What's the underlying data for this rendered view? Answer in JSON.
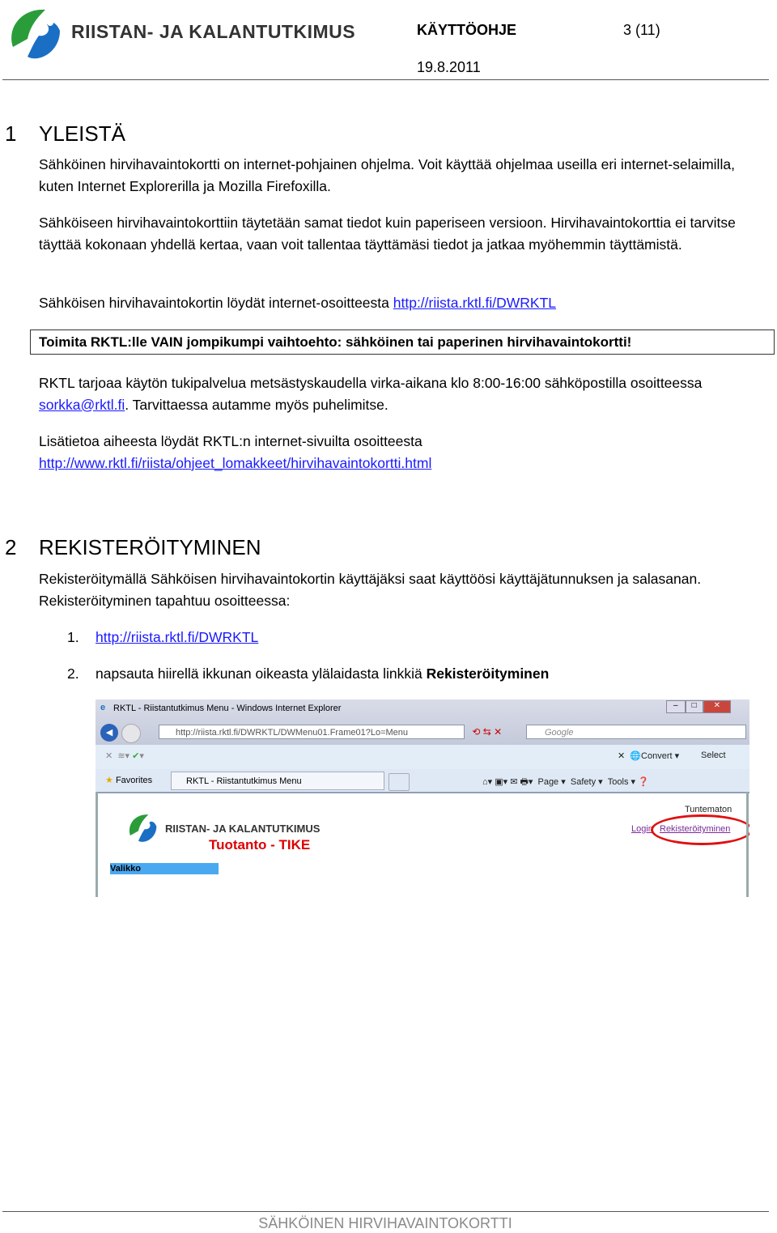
{
  "header": {
    "logo_text": "RIISTAN- JA KALANTUTKIMUS",
    "doc_type": "KÄYTTÖOHJE",
    "page": "3 (11)",
    "date": "19.8.2011"
  },
  "section1": {
    "number": "1",
    "title": "YLEISTÄ",
    "p1": "Sähköinen hirvihavaintokortti on internet-pohjainen ohjelma. Voit käyttää ohjelmaa useilla eri internet-selaimilla, kuten Internet Explorerilla ja Mozilla Firefoxilla.",
    "p2": "Sähköiseen hirvihavaintokorttiin täytetään samat tiedot kuin paperiseen versioon. Hirvihavaintokorttia ei tarvitse täyttää kokonaan yhdellä kertaa, vaan voit tallentaa täyttämäsi tiedot ja jatkaa myöhemmin täyttämistä.",
    "p3_text": "Sähköisen hirvihavaintokortin löydät internet-osoitteesta ",
    "p3_link": "http://riista.rktl.fi/DWRKTL",
    "notice": "Toimita RKTL:lle VAIN jompikumpi vaihtoehto: sähköinen tai paperinen hirvihavaintokortti!",
    "p4_text1": "RKTL tarjoaa käytön tukipalvelua metsästyskaudella virka-aikana klo 8:00-16:00 sähköpostilla osoitteessa ",
    "p4_link": "sorkka@rktl.fi",
    "p4_text2": ". Tarvittaessa autamme myös puhelimitse.",
    "p5_text": "Lisätietoa aiheesta löydät RKTL:n internet-sivuilta osoitteesta",
    "p5_link": "http://www.rktl.fi/riista/ohjeet_lomakkeet/hirvihavaintokortti.html"
  },
  "section2": {
    "number": "2",
    "title": "REKISTERÖITYMINEN",
    "p1": "Rekisteröitymällä Sähköisen hirvihavaintokortin käyttäjäksi saat käyttöösi käyttäjätunnuksen ja salasanan. Rekisteröityminen tapahtuu osoitteessa:",
    "list": [
      {
        "num": "1.",
        "link": "http://riista.rktl.fi/DWRKTL"
      },
      {
        "num": "2.",
        "text": "napsauta hiirellä ikkunan oikeasta ylälaidasta linkkiä ",
        "bold": "Rekisteröityminen"
      }
    ]
  },
  "screenshot": {
    "window_title": "RKTL - Riistantutkimus Menu - Windows Internet Explorer",
    "url": "http://riista.rktl.fi/DWRKTL/DWMenu01.Frame01?Lo=Menu",
    "search_placeholder": "Google",
    "convert": "Convert",
    "select": "Select",
    "favorites": "Favorites",
    "tab": "RKTL - Riistantutkimus Menu",
    "page_menu": "Page ▾",
    "safety_menu": "Safety ▾",
    "tools_menu": "Tools ▾",
    "logo_text": "RIISTAN- JA KALANTUTKIMUS",
    "subtitle": "Tuotanto - TIKE",
    "user": "Tuntematon",
    "login": "Login",
    "register": "Rekisteröityminen",
    "menu": "Valikko",
    "highlight_color": "#e01010"
  },
  "footer": {
    "text": "SÄHKÖINEN HIRVIHAVAINTOKORTTI"
  }
}
